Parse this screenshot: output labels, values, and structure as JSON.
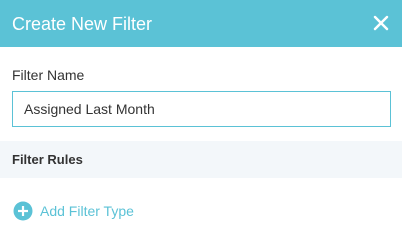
{
  "dialog": {
    "title": "Create New Filter",
    "close_icon": "close-icon"
  },
  "form": {
    "filter_name_label": "Filter Name",
    "filter_name_value": "Assigned Last Month"
  },
  "rules": {
    "section_title": "Filter Rules",
    "add_label": "Add Filter Type",
    "add_icon": "plus-circle-icon"
  },
  "colors": {
    "accent": "#5bc2d6",
    "section_bg": "#f3f7fa",
    "text": "#333333"
  }
}
